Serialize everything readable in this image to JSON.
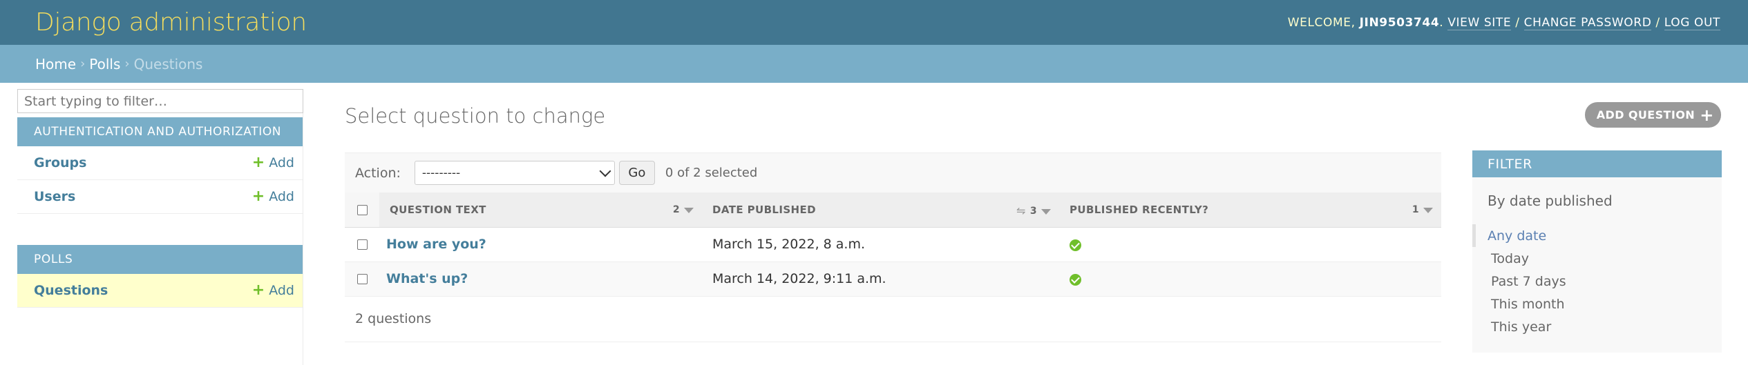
{
  "header": {
    "branding": "Django administration",
    "welcome": "Welcome,",
    "username": "JIN9503744",
    "view_site": "View site",
    "change_password": "Change password",
    "log_out": "Log out"
  },
  "breadcrumbs": {
    "home": "Home",
    "polls": "Polls",
    "current": "Questions"
  },
  "sidebar": {
    "filter_placeholder": "Start typing to filter…",
    "apps": [
      {
        "caption": "Authentication and Authorization",
        "models": [
          {
            "name": "Groups",
            "add": "Add"
          },
          {
            "name": "Users",
            "add": "Add"
          }
        ]
      },
      {
        "caption": "Polls",
        "models": [
          {
            "name": "Questions",
            "add": "Add"
          }
        ]
      }
    ]
  },
  "content": {
    "title": "Select question to change",
    "add_button": "Add question"
  },
  "actions": {
    "label": "Action:",
    "selected_option": "---------",
    "go": "Go",
    "counter": "0 of 2 selected"
  },
  "table": {
    "headers": [
      {
        "label": "Question text",
        "sort_priority": "2"
      },
      {
        "label": "Date published",
        "sort_priority": "3"
      },
      {
        "label": "Published recently?",
        "sort_priority": "1"
      }
    ],
    "rows": [
      {
        "question": "How are you?",
        "date": "March 15, 2022, 8 a.m.",
        "recent": "true"
      },
      {
        "question": "What's up?",
        "date": "March 14, 2022, 9:11 a.m.",
        "recent": "true"
      }
    ],
    "paginator": "2 questions"
  },
  "filter": {
    "title": "Filter",
    "group_title": "By date published",
    "options": [
      "Any date",
      "Today",
      "Past 7 days",
      "This month",
      "This year"
    ],
    "selected": "Any date"
  },
  "colors": {
    "header_bg": "#417690",
    "branding": "#f5dd5d",
    "breadcrumb_bg": "#79aec8",
    "link": "#447e9b",
    "add_green": "#70bf2b",
    "current_row": "#ffffcc"
  }
}
